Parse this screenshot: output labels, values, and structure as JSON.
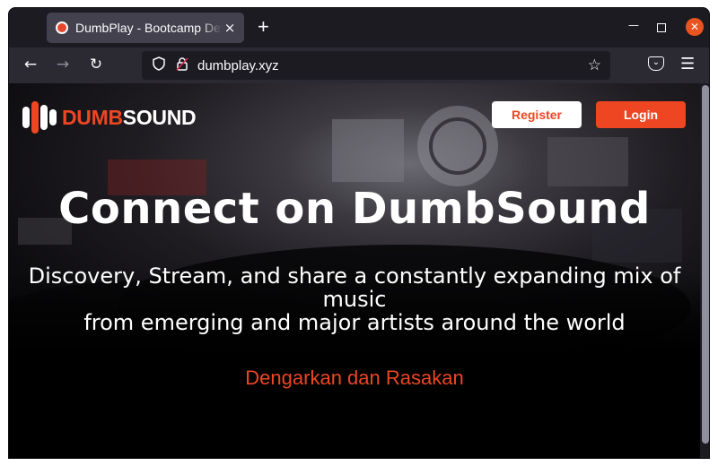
{
  "browser": {
    "tab_title": "DumbPlay - Bootcamp Dev",
    "tab_close": "×",
    "new_tab": "+",
    "url": "dumbplay.xyz",
    "icons": {
      "back": "back-arrow-icon",
      "forward": "forward-arrow-icon",
      "reload": "reload-icon",
      "shield": "shield-icon",
      "lock": "lock-icon",
      "star": "bookmark-star-icon",
      "pocket": "pocket-icon",
      "menu": "hamburger-menu-icon"
    }
  },
  "site": {
    "logo": {
      "part1": "DUMB",
      "part2": "SOUND"
    },
    "nav": {
      "register_label": "Register",
      "login_label": "Login"
    },
    "hero": {
      "headline": "Connect on DumbSound",
      "subtitle_line1": "Discovery, Stream, and share a constantly expanding mix of music",
      "subtitle_line2": "from emerging and major artists around the world"
    },
    "tagline": "Dengarkan dan Rasakan"
  },
  "colors": {
    "accent": "#ee4622",
    "browser_frame": "#1c1b22",
    "toolbar": "#2b2a33",
    "active_tab": "#42414d",
    "close_button": "#e95420",
    "page_background": "#000000"
  }
}
